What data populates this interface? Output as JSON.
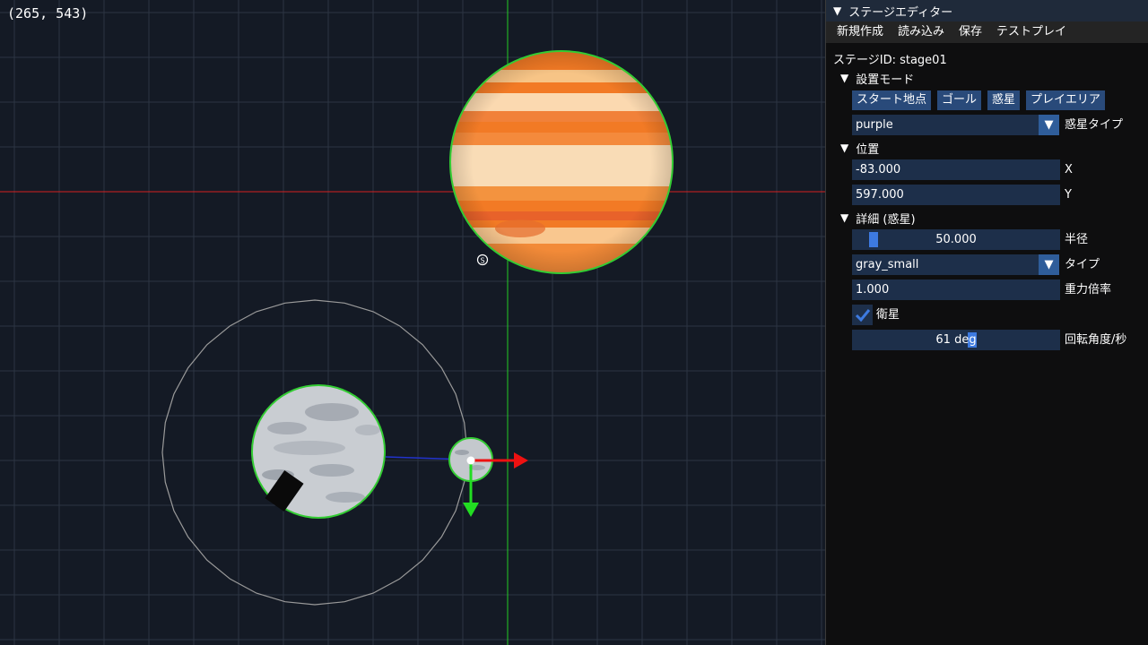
{
  "viewport": {
    "cursor_coord": "(265, 543)"
  },
  "editor": {
    "title": "ステージエディター",
    "menu": [
      "新規作成",
      "読み込み",
      "保存",
      "テストプレイ"
    ],
    "stage_id": "ステージID: stage01",
    "placement_mode": {
      "header": "設置モード",
      "buttons": [
        "スタート地点",
        "ゴール",
        "惑星",
        "プレイエリア"
      ]
    },
    "planet_type": {
      "value": "purple",
      "label": "惑星タイプ"
    },
    "position": {
      "header": "位置",
      "x_value": "-83.000",
      "x_label": "X",
      "y_value": "597.000",
      "y_label": "Y"
    },
    "details": {
      "header": "詳細 (惑星)",
      "radius_value": "50.000",
      "radius_label": "半径",
      "type_value": "gray_small",
      "type_label": "タイプ",
      "gravity_value": "1.000",
      "gravity_label": "重力倍率",
      "satellite_label": "衛星",
      "satellite_checked": true,
      "rotation_value": "61 deg",
      "rotation_label": "回転角度/秒"
    }
  },
  "colors": {
    "accent": "#3d7ae0",
    "button": "#294a7a",
    "field": "#1d2f4a",
    "selection_outline": "#33cc33"
  }
}
